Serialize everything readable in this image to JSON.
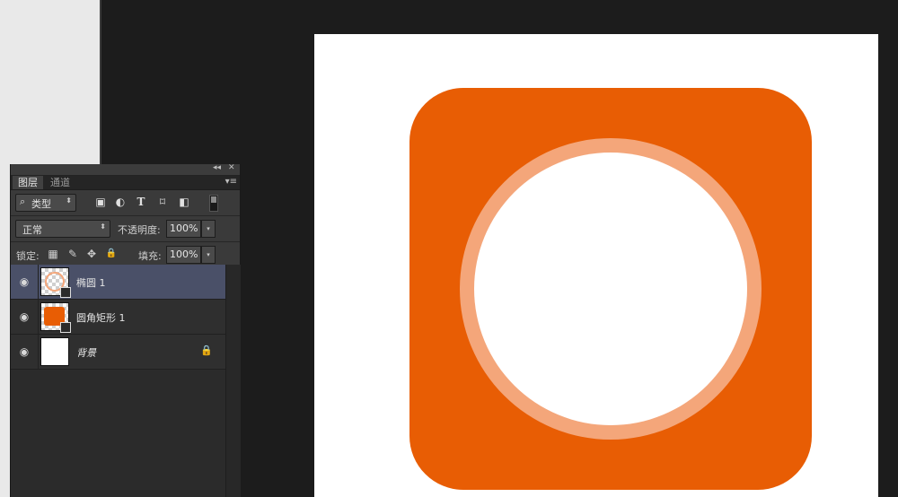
{
  "panel": {
    "topbar": {
      "collapse_glyph": "◂◂",
      "close_glyph": "✕"
    },
    "tabs": [
      {
        "label": "图层",
        "active": true
      },
      {
        "label": "通道",
        "active": false
      }
    ],
    "menu_glyph": "▾≡",
    "filter": {
      "icon": "search-icon",
      "glyph": "⌕",
      "value": "类型",
      "arrow": "⬍"
    },
    "filter_icons": [
      {
        "name": "image-filter-icon",
        "glyph": "▣"
      },
      {
        "name": "adjustment-filter-icon",
        "glyph": "◐"
      },
      {
        "name": "text-filter-icon",
        "glyph": "T"
      },
      {
        "name": "shape-filter-icon",
        "glyph": "⌑"
      },
      {
        "name": "smart-object-filter-icon",
        "glyph": "◧"
      }
    ],
    "blend": {
      "value": "正常",
      "arrow": "⬍"
    },
    "opacity": {
      "label": "不透明度:",
      "value": "100%",
      "drop": "▾"
    },
    "lock": {
      "label": "锁定:",
      "icons": [
        {
          "name": "lock-transparent-icon",
          "glyph": "▦"
        },
        {
          "name": "lock-paint-icon",
          "glyph": "✎"
        },
        {
          "name": "lock-move-icon",
          "glyph": "✥"
        },
        {
          "name": "lock-all-icon",
          "glyph": "🔒"
        }
      ]
    },
    "fill": {
      "label": "填充:",
      "value": "100%",
      "drop": "▾"
    },
    "layers": [
      {
        "name": "椭圆 1",
        "selected": true,
        "thumb": "ellipse",
        "visible_glyph": "◉"
      },
      {
        "name": "圆角矩形 1",
        "selected": false,
        "thumb": "rounded-rect",
        "visible_glyph": "◉"
      },
      {
        "name": "背景",
        "selected": false,
        "thumb": "background",
        "visible_glyph": "◉",
        "locked_glyph": "🔒"
      }
    ]
  },
  "colors": {
    "shape_orange": "#e85d04",
    "ring_orange": "#f4a67a",
    "canvas_white": "#ffffff",
    "selected_layer": "#4a5068"
  }
}
